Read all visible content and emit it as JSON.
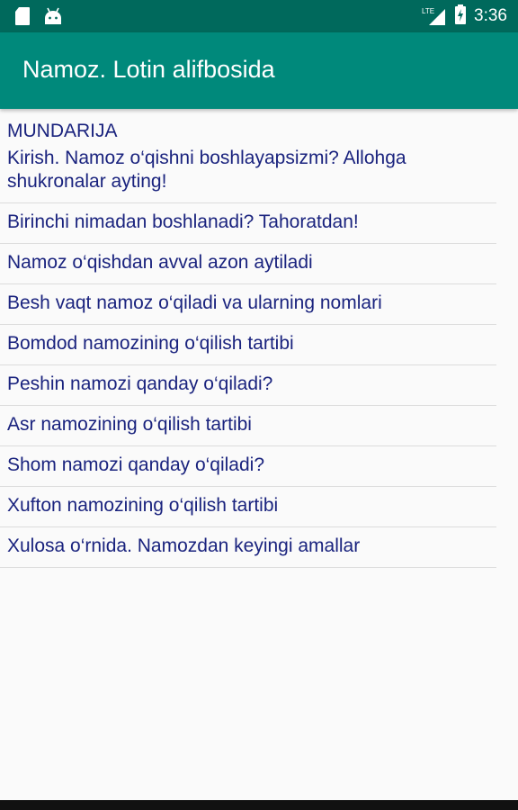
{
  "status_bar": {
    "time": "3:36",
    "network_label": "LTE",
    "icons": [
      "sd-card-icon",
      "android-icon",
      "signal-icon",
      "battery-charging-icon"
    ]
  },
  "app_bar": {
    "title": "Namoz. Lotin alifbosida"
  },
  "contents": {
    "heading": "MUNDARIJA",
    "items": [
      "Kirish. Namoz o‘qishni boshlayapsizmi? Allohga shukronalar ayting!",
      "Birinchi nimadan boshlanadi? Tahoratdan!",
      "Namoz o‘qishdan avval azon aytiladi",
      "Besh vaqt namoz o‘qiladi va ularning nomlari",
      "Bomdod namozining o‘qilish tartibi",
      "Peshin namozi qanday o‘qiladi?",
      "Asr namozining o‘qilish tartibi",
      "Shom namozi qanday o‘qiladi?",
      "Xufton namozining o‘qilish tartibi",
      "Xulosa o‘rnida. Namozdan keyingi amallar"
    ]
  },
  "colors": {
    "status_bar": "#00695c",
    "app_bar": "#00897b",
    "text": "#1a237e",
    "divider": "#dcdcdc",
    "background": "#fafafa"
  }
}
